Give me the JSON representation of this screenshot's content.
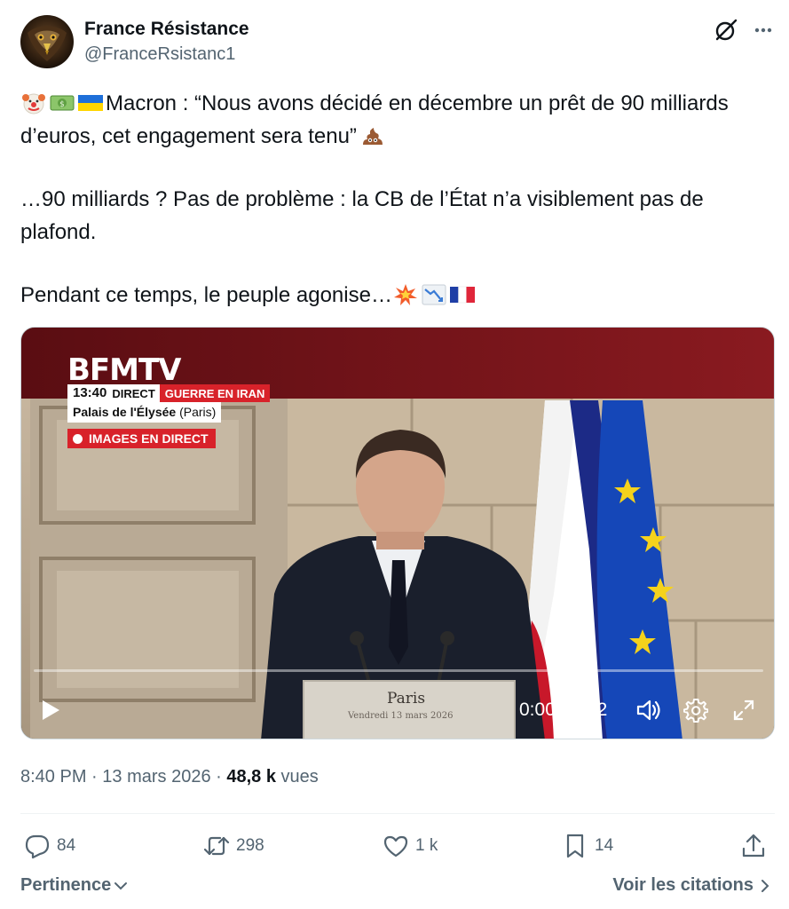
{
  "author": {
    "display_name": "France Résistance",
    "handle": "@FranceRsistanc1",
    "avatar_icon": "eagle-avatar"
  },
  "header_icons": {
    "grok": "grok-icon",
    "more": "more-dots-icon"
  },
  "tweet": {
    "paragraphs": [
      {
        "lead_emojis": [
          "clown-face-emoji",
          "money-banknote-emoji",
          "ukraine-flag-emoji"
        ],
        "text": "Macron : “Nous avons décidé en décembre un prêt de 90 milliards d’euros, cet engagement sera tenu”",
        "trail_emojis": [
          "pile-of-poo-emoji"
        ]
      },
      {
        "text": "…90 milliards ? Pas de problème : la CB de l’État n’a visiblement pas de plafond."
      },
      {
        "text": "Pendant ce temps, le peuple agonise…",
        "trail_emojis": [
          "collision-emoji",
          "chart-decreasing-emoji",
          "france-flag-emoji"
        ]
      }
    ]
  },
  "video": {
    "overlay": {
      "channel": "BFMTV",
      "time": "13:40",
      "live_label": "DIRECT",
      "topic": "GUERRE EN IRAN",
      "location": "Palais de l'Élysée",
      "location_city": "(Paris)",
      "live_images": "IMAGES EN DIRECT"
    },
    "podium": {
      "line1": "Paris",
      "line2": "Vendredi 13 mars 2026"
    },
    "time_readout": "0:00 / 2:12",
    "progress": 0.0
  },
  "meta": {
    "time": "8:40 PM",
    "separator": " · ",
    "date": "13 mars 2026",
    "views_count": "48,8 k",
    "views_label": "vues"
  },
  "actions": {
    "replies": "84",
    "retweets": "298",
    "likes": "1 k",
    "bookmarks": "14"
  },
  "footer": {
    "sort_label": "Pertinence",
    "quotes_label": "Voir les citations"
  },
  "colors": {
    "text": "#0f1419",
    "muted": "#536471",
    "divider": "#eff3f4",
    "bfm_red": "#d8222a"
  }
}
